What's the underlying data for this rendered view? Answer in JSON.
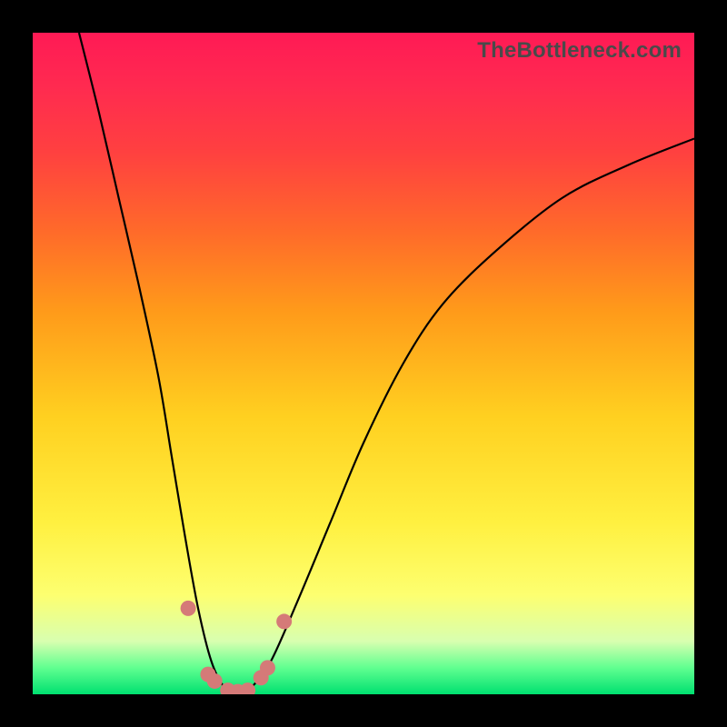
{
  "watermark": "TheBottleneck.com",
  "chart_data": {
    "type": "line",
    "title": "",
    "xlabel": "",
    "ylabel": "",
    "xlim": [
      0,
      100
    ],
    "ylim": [
      0,
      100
    ],
    "grid": false,
    "legend": false,
    "series": [
      {
        "name": "bottleneck-curve",
        "x": [
          7,
          10,
          13,
          16,
          19,
          21,
          23,
          25,
          27,
          29,
          31,
          33,
          36,
          40,
          45,
          50,
          56,
          62,
          70,
          80,
          90,
          100
        ],
        "values": [
          100,
          88,
          75,
          62,
          48,
          36,
          24,
          13,
          5,
          1,
          0,
          1,
          5,
          14,
          26,
          38,
          50,
          59,
          67,
          75,
          80,
          84
        ]
      }
    ],
    "markers": [
      {
        "name": "dot-left-upper",
        "x": 23.5,
        "y": 13
      },
      {
        "name": "dot-left-lower-a",
        "x": 26.5,
        "y": 3
      },
      {
        "name": "dot-left-lower-b",
        "x": 27.5,
        "y": 2
      },
      {
        "name": "dot-bottom-a",
        "x": 29.5,
        "y": 0.6
      },
      {
        "name": "dot-bottom-b",
        "x": 31.0,
        "y": 0.4
      },
      {
        "name": "dot-bottom-c",
        "x": 32.5,
        "y": 0.6
      },
      {
        "name": "dot-right-lower-a",
        "x": 34.5,
        "y": 2.5
      },
      {
        "name": "dot-right-lower-b",
        "x": 35.5,
        "y": 4
      },
      {
        "name": "dot-right-upper",
        "x": 38.0,
        "y": 11
      }
    ]
  }
}
